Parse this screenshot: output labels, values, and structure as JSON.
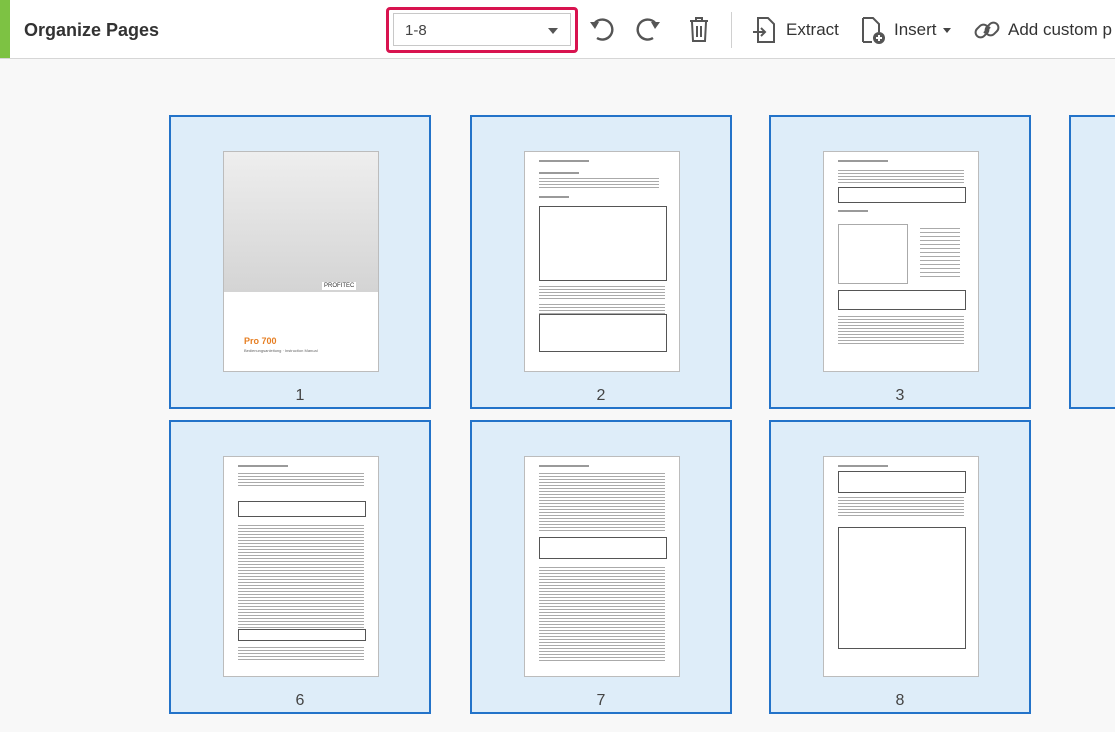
{
  "toolbar": {
    "title": "Organize Pages",
    "page_range": "1-8",
    "extract_label": "Extract",
    "insert_label": "Insert",
    "add_custom_label": "Add custom p"
  },
  "thumbnails": [
    {
      "label": "1",
      "cover_title": "Pro 700",
      "cover_subtitle": "Bedienungsanleitung · Instruction Manual",
      "cover_brand": "PROFITEC"
    },
    {
      "label": "2"
    },
    {
      "label": "3"
    },
    {
      "label": "6"
    },
    {
      "label": "7"
    },
    {
      "label": "8"
    }
  ],
  "colors": {
    "accent": "#7dc243",
    "selection_border": "#2373c9",
    "selection_fill": "#deedf9",
    "highlight": "#d8134f"
  }
}
